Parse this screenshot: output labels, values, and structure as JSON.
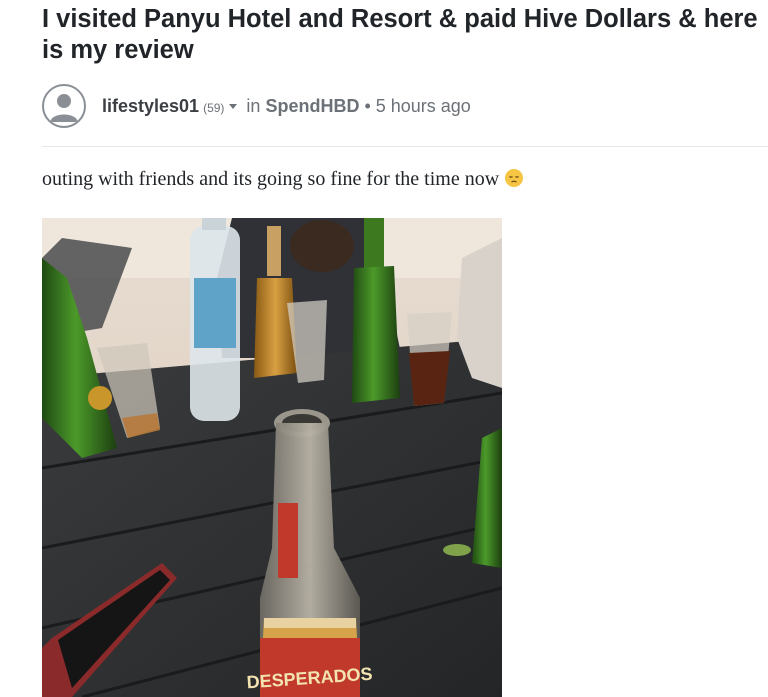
{
  "post": {
    "title": "I visited Panyu Hotel and Resort & paid Hive Dollars & here is my review",
    "author": "lifestyles01",
    "reputation": "(59)",
    "in_label": "in",
    "community": "SpendHBD",
    "separator": "•",
    "timestamp": "5 hours ago",
    "body": "outing with friends and its going so fine for the time now"
  },
  "icons": {
    "avatar": "user-placeholder-icon",
    "author_menu": "caret-down-icon",
    "emoji": "pensive-face-emoji"
  },
  "photo": {
    "label_text": "DESPERADOS",
    "description_colors": {
      "table": "#2b2d2f",
      "green_bottle": "#3a7a1e",
      "amber": "#c88a2a"
    }
  },
  "colors": {
    "title": "#212529",
    "meta_gray": "#6b7177",
    "divider": "#e6e6e6"
  }
}
